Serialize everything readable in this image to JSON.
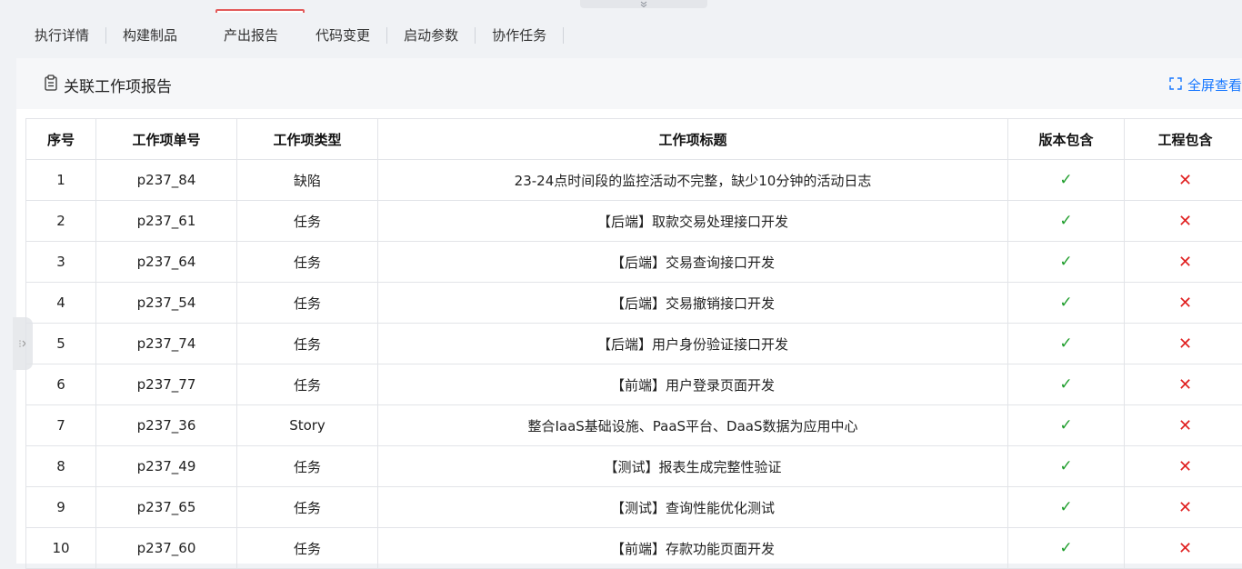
{
  "tabs": [
    {
      "label": "执行详情",
      "active": false
    },
    {
      "label": "构建制品",
      "active": false
    },
    {
      "label": "产出报告",
      "active": true
    },
    {
      "label": "代码变更",
      "active": false
    },
    {
      "label": "启动参数",
      "active": false
    },
    {
      "label": "协作任务",
      "active": false
    }
  ],
  "report": {
    "title": "关联工作项报告",
    "fullscreen_label": "全屏查看",
    "icon": "clipboard-icon"
  },
  "table": {
    "headers": [
      "序号",
      "工作项单号",
      "工作项类型",
      "工作项标题",
      "版本包含",
      "工程包含"
    ],
    "rows": [
      {
        "no": "1",
        "id": "p237_84",
        "type": "缺陷",
        "title": "23-24点时间段的监控活动不完整，缺少10分钟的活动日志",
        "in_version": "✓",
        "in_project": "✕"
      },
      {
        "no": "2",
        "id": "p237_61",
        "type": "任务",
        "title": "【后端】取款交易处理接口开发",
        "in_version": "✓",
        "in_project": "✕"
      },
      {
        "no": "3",
        "id": "p237_64",
        "type": "任务",
        "title": "【后端】交易查询接口开发",
        "in_version": "✓",
        "in_project": "✕"
      },
      {
        "no": "4",
        "id": "p237_54",
        "type": "任务",
        "title": "【后端】交易撤销接口开发",
        "in_version": "✓",
        "in_project": "✕"
      },
      {
        "no": "5",
        "id": "p237_74",
        "type": "任务",
        "title": "【后端】用户身份验证接口开发",
        "in_version": "✓",
        "in_project": "✕"
      },
      {
        "no": "6",
        "id": "p237_77",
        "type": "任务",
        "title": "【前端】用户登录页面开发",
        "in_version": "✓",
        "in_project": "✕"
      },
      {
        "no": "7",
        "id": "p237_36",
        "type": "Story",
        "title": "整合IaaS基础设施、PaaS平台、DaaS数据为应用中心",
        "in_version": "✓",
        "in_project": "✕"
      },
      {
        "no": "8",
        "id": "p237_49",
        "type": "任务",
        "title": "【测试】报表生成完整性验证",
        "in_version": "✓",
        "in_project": "✕"
      },
      {
        "no": "9",
        "id": "p237_65",
        "type": "任务",
        "title": "【测试】查询性能优化测试",
        "in_version": "✓",
        "in_project": "✕"
      },
      {
        "no": "10",
        "id": "p237_60",
        "type": "任务",
        "title": "【前端】存款功能页面开发",
        "in_version": "✓",
        "in_project": "✕"
      }
    ]
  },
  "colors": {
    "accent": "#1677ff",
    "highlight_border": "#e35a5a",
    "check": "#1e9d2b",
    "cross": "#e02020"
  }
}
